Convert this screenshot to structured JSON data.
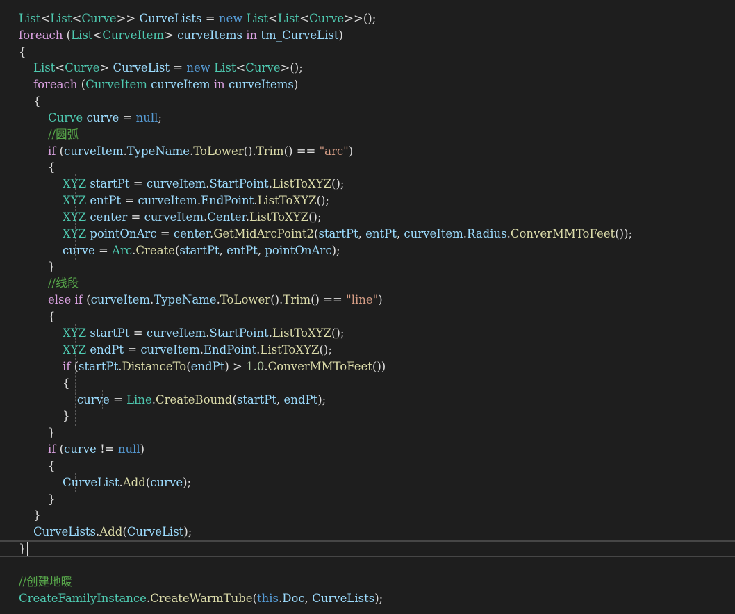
{
  "editor": {
    "theme_colors": {
      "background": "#1e1e1e",
      "keyword": "#569cd6",
      "control_keyword": "#d8a0df",
      "type": "#4ec9b0",
      "identifier": "#9cdcfe",
      "method": "#dcdcaa",
      "string": "#d69d85",
      "number": "#b5cea8",
      "comment": "#57a64a",
      "punctuation": "#dcdcdc"
    },
    "current_line": 32,
    "lines": [
      [
        [
          "t",
          "List"
        ],
        [
          "p",
          "<"
        ],
        [
          "t",
          "List"
        ],
        [
          "p",
          "<"
        ],
        [
          "t",
          "Curve"
        ],
        [
          "p",
          ">> "
        ],
        [
          "v",
          "CurveLists"
        ],
        [
          "p",
          " = "
        ],
        [
          "k",
          "new"
        ],
        [
          "p",
          " "
        ],
        [
          "t",
          "List"
        ],
        [
          "p",
          "<"
        ],
        [
          "t",
          "List"
        ],
        [
          "p",
          "<"
        ],
        [
          "t",
          "Curve"
        ],
        [
          "p",
          ">>();"
        ]
      ],
      [
        [
          "kc",
          "foreach"
        ],
        [
          "p",
          " ("
        ],
        [
          "t",
          "List"
        ],
        [
          "p",
          "<"
        ],
        [
          "t",
          "CurveItem"
        ],
        [
          "p",
          "> "
        ],
        [
          "v",
          "curveItems"
        ],
        [
          "p",
          " "
        ],
        [
          "kc",
          "in"
        ],
        [
          "p",
          " "
        ],
        [
          "v",
          "tm_CurveList"
        ],
        [
          "p",
          ")"
        ]
      ],
      [
        [
          "p",
          "{"
        ]
      ],
      [
        [
          "p",
          "    "
        ],
        [
          "t",
          "List"
        ],
        [
          "p",
          "<"
        ],
        [
          "t",
          "Curve"
        ],
        [
          "p",
          "> "
        ],
        [
          "v",
          "CurveList"
        ],
        [
          "p",
          " = "
        ],
        [
          "k",
          "new"
        ],
        [
          "p",
          " "
        ],
        [
          "t",
          "List"
        ],
        [
          "p",
          "<"
        ],
        [
          "t",
          "Curve"
        ],
        [
          "p",
          ">();"
        ]
      ],
      [
        [
          "p",
          "    "
        ],
        [
          "kc",
          "foreach"
        ],
        [
          "p",
          " ("
        ],
        [
          "t",
          "CurveItem"
        ],
        [
          "p",
          " "
        ],
        [
          "v",
          "curveItem"
        ],
        [
          "p",
          " "
        ],
        [
          "kc",
          "in"
        ],
        [
          "p",
          " "
        ],
        [
          "v",
          "curveItems"
        ],
        [
          "p",
          ")"
        ]
      ],
      [
        [
          "p",
          "    {"
        ]
      ],
      [
        [
          "p",
          "        "
        ],
        [
          "t",
          "Curve"
        ],
        [
          "p",
          " "
        ],
        [
          "v",
          "curve"
        ],
        [
          "p",
          " = "
        ],
        [
          "k",
          "null"
        ],
        [
          "p",
          ";"
        ]
      ],
      [
        [
          "p",
          "        "
        ],
        [
          "c",
          "//圆弧"
        ]
      ],
      [
        [
          "p",
          "        "
        ],
        [
          "kc",
          "if"
        ],
        [
          "p",
          " ("
        ],
        [
          "v",
          "curveItem"
        ],
        [
          "p",
          "."
        ],
        [
          "v",
          "TypeName"
        ],
        [
          "p",
          "."
        ],
        [
          "m",
          "ToLower"
        ],
        [
          "p",
          "()."
        ],
        [
          "m",
          "Trim"
        ],
        [
          "p",
          "() == "
        ],
        [
          "s",
          "\"arc\""
        ],
        [
          "p",
          ")"
        ]
      ],
      [
        [
          "p",
          "        {"
        ]
      ],
      [
        [
          "p",
          "            "
        ],
        [
          "t",
          "XYZ"
        ],
        [
          "p",
          " "
        ],
        [
          "v",
          "startPt"
        ],
        [
          "p",
          " = "
        ],
        [
          "v",
          "curveItem"
        ],
        [
          "p",
          "."
        ],
        [
          "v",
          "StartPoint"
        ],
        [
          "p",
          "."
        ],
        [
          "m",
          "ListToXYZ"
        ],
        [
          "p",
          "();"
        ]
      ],
      [
        [
          "p",
          "            "
        ],
        [
          "t",
          "XYZ"
        ],
        [
          "p",
          " "
        ],
        [
          "v",
          "entPt"
        ],
        [
          "p",
          " = "
        ],
        [
          "v",
          "curveItem"
        ],
        [
          "p",
          "."
        ],
        [
          "v",
          "EndPoint"
        ],
        [
          "p",
          "."
        ],
        [
          "m",
          "ListToXYZ"
        ],
        [
          "p",
          "();"
        ]
      ],
      [
        [
          "p",
          "            "
        ],
        [
          "t",
          "XYZ"
        ],
        [
          "p",
          " "
        ],
        [
          "v",
          "center"
        ],
        [
          "p",
          " = "
        ],
        [
          "v",
          "curveItem"
        ],
        [
          "p",
          "."
        ],
        [
          "v",
          "Center"
        ],
        [
          "p",
          "."
        ],
        [
          "m",
          "ListToXYZ"
        ],
        [
          "p",
          "();"
        ]
      ],
      [
        [
          "p",
          "            "
        ],
        [
          "t",
          "XYZ"
        ],
        [
          "p",
          " "
        ],
        [
          "v",
          "pointOnArc"
        ],
        [
          "p",
          " = "
        ],
        [
          "v",
          "center"
        ],
        [
          "p",
          "."
        ],
        [
          "m",
          "GetMidArcPoint2"
        ],
        [
          "p",
          "("
        ],
        [
          "v",
          "startPt"
        ],
        [
          "p",
          ", "
        ],
        [
          "v",
          "entPt"
        ],
        [
          "p",
          ", "
        ],
        [
          "v",
          "curveItem"
        ],
        [
          "p",
          "."
        ],
        [
          "v",
          "Radius"
        ],
        [
          "p",
          "."
        ],
        [
          "m",
          "ConverMMToFeet"
        ],
        [
          "p",
          "());"
        ]
      ],
      [
        [
          "p",
          "            "
        ],
        [
          "v",
          "curve"
        ],
        [
          "p",
          " = "
        ],
        [
          "t",
          "Arc"
        ],
        [
          "p",
          "."
        ],
        [
          "m",
          "Create"
        ],
        [
          "p",
          "("
        ],
        [
          "v",
          "startPt"
        ],
        [
          "p",
          ", "
        ],
        [
          "v",
          "entPt"
        ],
        [
          "p",
          ", "
        ],
        [
          "v",
          "pointOnArc"
        ],
        [
          "p",
          ");"
        ]
      ],
      [
        [
          "p",
          "        }"
        ]
      ],
      [
        [
          "p",
          "        "
        ],
        [
          "c",
          "//线段"
        ]
      ],
      [
        [
          "p",
          "        "
        ],
        [
          "kc",
          "else"
        ],
        [
          "p",
          " "
        ],
        [
          "kc",
          "if"
        ],
        [
          "p",
          " ("
        ],
        [
          "v",
          "curveItem"
        ],
        [
          "p",
          "."
        ],
        [
          "v",
          "TypeName"
        ],
        [
          "p",
          "."
        ],
        [
          "m",
          "ToLower"
        ],
        [
          "p",
          "()."
        ],
        [
          "m",
          "Trim"
        ],
        [
          "p",
          "() == "
        ],
        [
          "s",
          "\"line\""
        ],
        [
          "p",
          ")"
        ]
      ],
      [
        [
          "p",
          "        {"
        ]
      ],
      [
        [
          "p",
          "            "
        ],
        [
          "t",
          "XYZ"
        ],
        [
          "p",
          " "
        ],
        [
          "v",
          "startPt"
        ],
        [
          "p",
          " = "
        ],
        [
          "v",
          "curveItem"
        ],
        [
          "p",
          "."
        ],
        [
          "v",
          "StartPoint"
        ],
        [
          "p",
          "."
        ],
        [
          "m",
          "ListToXYZ"
        ],
        [
          "p",
          "();"
        ]
      ],
      [
        [
          "p",
          "            "
        ],
        [
          "t",
          "XYZ"
        ],
        [
          "p",
          " "
        ],
        [
          "v",
          "endPt"
        ],
        [
          "p",
          " = "
        ],
        [
          "v",
          "curveItem"
        ],
        [
          "p",
          "."
        ],
        [
          "v",
          "EndPoint"
        ],
        [
          "p",
          "."
        ],
        [
          "m",
          "ListToXYZ"
        ],
        [
          "p",
          "();"
        ]
      ],
      [
        [
          "p",
          "            "
        ],
        [
          "kc",
          "if"
        ],
        [
          "p",
          " ("
        ],
        [
          "v",
          "startPt"
        ],
        [
          "p",
          "."
        ],
        [
          "m",
          "DistanceTo"
        ],
        [
          "p",
          "("
        ],
        [
          "v",
          "endPt"
        ],
        [
          "p",
          ") > "
        ],
        [
          "n",
          "1.0"
        ],
        [
          "p",
          "."
        ],
        [
          "m",
          "ConverMMToFeet"
        ],
        [
          "p",
          "())"
        ]
      ],
      [
        [
          "p",
          "            {"
        ]
      ],
      [
        [
          "p",
          "                "
        ],
        [
          "v",
          "curve"
        ],
        [
          "p",
          " = "
        ],
        [
          "t",
          "Line"
        ],
        [
          "p",
          "."
        ],
        [
          "m",
          "CreateBound"
        ],
        [
          "p",
          "("
        ],
        [
          "v",
          "startPt"
        ],
        [
          "p",
          ", "
        ],
        [
          "v",
          "endPt"
        ],
        [
          "p",
          ");"
        ]
      ],
      [
        [
          "p",
          "            }"
        ]
      ],
      [
        [
          "p",
          "        }"
        ]
      ],
      [
        [
          "p",
          "        "
        ],
        [
          "kc",
          "if"
        ],
        [
          "p",
          " ("
        ],
        [
          "v",
          "curve"
        ],
        [
          "p",
          " != "
        ],
        [
          "k",
          "null"
        ],
        [
          "p",
          ")"
        ]
      ],
      [
        [
          "p",
          "        {"
        ]
      ],
      [
        [
          "p",
          "            "
        ],
        [
          "v",
          "CurveList"
        ],
        [
          "p",
          "."
        ],
        [
          "m",
          "Add"
        ],
        [
          "p",
          "("
        ],
        [
          "v",
          "curve"
        ],
        [
          "p",
          ");"
        ]
      ],
      [
        [
          "p",
          "        }"
        ]
      ],
      [
        [
          "p",
          "    }"
        ]
      ],
      [
        [
          "p",
          "    "
        ],
        [
          "v",
          "CurveLists"
        ],
        [
          "p",
          "."
        ],
        [
          "m",
          "Add"
        ],
        [
          "p",
          "("
        ],
        [
          "v",
          "CurveList"
        ],
        [
          "p",
          ");"
        ]
      ],
      [
        [
          "p",
          "}"
        ]
      ],
      [],
      [
        [
          "c",
          "//创建地暖"
        ]
      ],
      [
        [
          "t",
          "CreateFamilyInstance"
        ],
        [
          "p",
          "."
        ],
        [
          "m",
          "CreateWarmTube"
        ],
        [
          "p",
          "("
        ],
        [
          "k",
          "this"
        ],
        [
          "p",
          "."
        ],
        [
          "v",
          "Doc"
        ],
        [
          "p",
          ", "
        ],
        [
          "v",
          "CurveLists"
        ],
        [
          "p",
          ");"
        ]
      ]
    ]
  }
}
